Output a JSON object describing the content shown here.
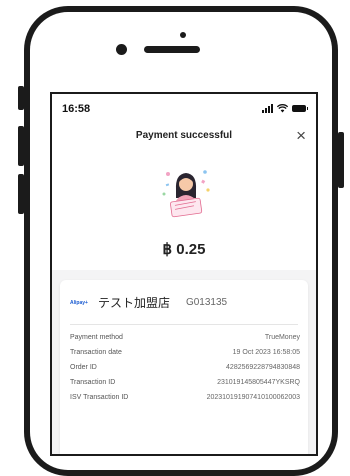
{
  "status_bar": {
    "time": "16:58"
  },
  "nav": {
    "title": "Payment successful",
    "close_icon": "×"
  },
  "amount": "฿ 0.25",
  "merchant": {
    "logo": "Alipay+",
    "name": "テスト加盟店",
    "code": "G013135"
  },
  "details": [
    {
      "label": "Payment method",
      "value": "TrueMoney"
    },
    {
      "label": "Transaction date",
      "value": "19 Oct 2023 16:58:05"
    },
    {
      "label": "Order ID",
      "value": "428256922879483084​8"
    },
    {
      "label": "Transaction ID",
      "value": "231019145805447YKSRQ"
    },
    {
      "label": "ISV Transaction ID",
      "value": "20231019190741010006200​3"
    }
  ],
  "colors": {
    "frame": "#1b1b1b",
    "screen_bg": "#f4f4f5",
    "accent": "#1a5bd1"
  }
}
